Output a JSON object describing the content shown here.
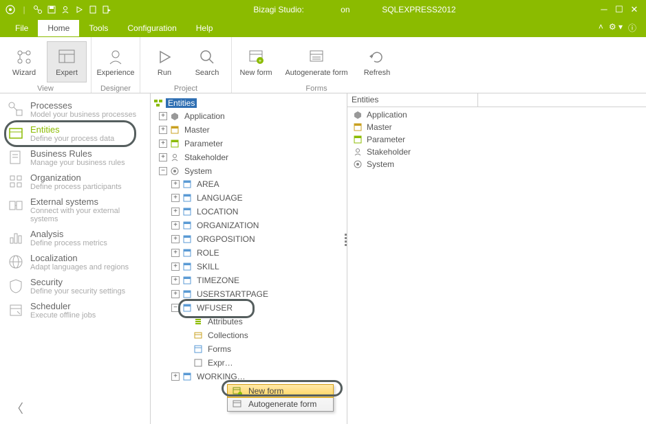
{
  "title": {
    "app": "Bizagi Studio:",
    "server": "on",
    "db": "SQLEXPRESS2012"
  },
  "menu": {
    "file": "File",
    "home": "Home",
    "tools": "Tools",
    "configuration": "Configuration",
    "help": "Help"
  },
  "ribbon": {
    "wizard": "Wizard",
    "expert": "Expert",
    "experience": "Experience",
    "run": "Run",
    "search": "Search",
    "newform": "New form",
    "autogen": "Autogenerate form",
    "refresh": "Refresh",
    "grp_view": "View",
    "grp_designer": "Designer",
    "grp_project": "Project",
    "grp_forms": "Forms"
  },
  "sidebar": {
    "items": [
      {
        "title": "Processes",
        "sub": "Model your business processes"
      },
      {
        "title": "Entities",
        "sub": "Define your process data"
      },
      {
        "title": "Business Rules",
        "sub": "Manage your business rules"
      },
      {
        "title": "Organization",
        "sub": "Define process participants"
      },
      {
        "title": "External systems",
        "sub": "Connect with your external systems"
      },
      {
        "title": "Analysis",
        "sub": "Define process metrics"
      },
      {
        "title": "Localization",
        "sub": "Adapt languages and regions"
      },
      {
        "title": "Security",
        "sub": "Define your security settings"
      },
      {
        "title": "Scheduler",
        "sub": "Execute offline jobs"
      }
    ]
  },
  "tree": {
    "root": "Entities",
    "application": "Application",
    "master": "Master",
    "parameter": "Parameter",
    "stakeholder": "Stakeholder",
    "system": "System",
    "system_children": [
      "AREA",
      "LANGUAGE",
      "LOCATION",
      "ORGANIZATION",
      "ORGPOSITION",
      "ROLE",
      "SKILL",
      "TIMEZONE",
      "USERSTARTPAGE",
      "WFUSER",
      "WORKING"
    ],
    "wfuser_children": [
      "Attributes",
      "Collections",
      "Forms",
      "Expr"
    ]
  },
  "rightpanel": {
    "header": "Entities",
    "items": [
      "Application",
      "Master",
      "Parameter",
      "Stakeholder",
      "System"
    ]
  },
  "context": {
    "newform": "New form",
    "autogen": "Autogenerate form"
  }
}
